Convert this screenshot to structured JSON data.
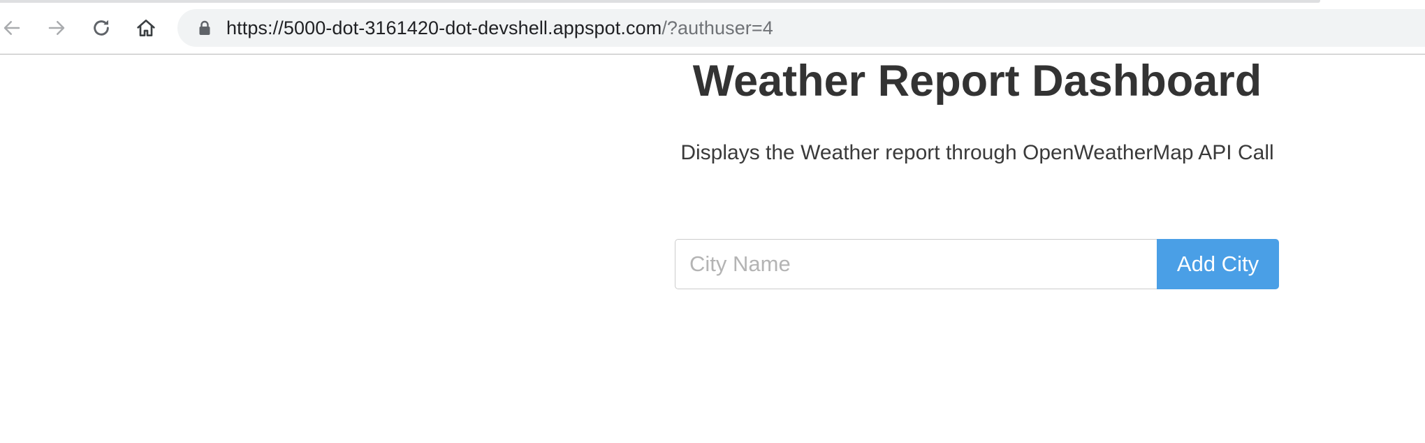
{
  "browser": {
    "url_host": "https://5000-dot-3161420-dot-devshell.appspot.com",
    "url_path": "/?authuser=4",
    "icons": {
      "back": "back-arrow-icon",
      "forward": "forward-arrow-icon",
      "reload": "reload-icon",
      "home": "home-icon",
      "lock": "lock-icon"
    }
  },
  "page": {
    "title": "Weather Report Dashboard",
    "subtitle": "Displays the Weather report through OpenWeatherMap API Call"
  },
  "form": {
    "city_value": "",
    "city_placeholder": "City Name",
    "add_button_label": "Add City"
  },
  "colors": {
    "accent": "#4a9fe6",
    "title_text": "#333333",
    "omnibox_bg": "#f1f3f4"
  }
}
